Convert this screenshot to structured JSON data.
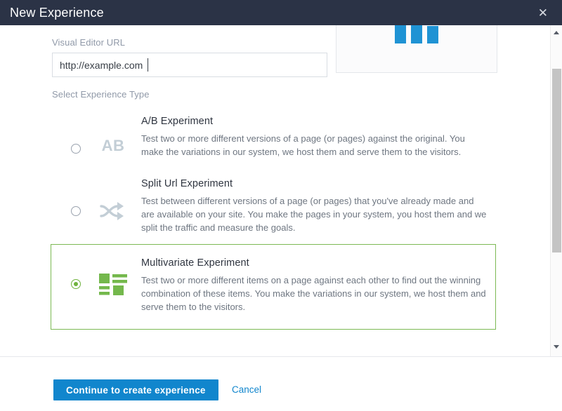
{
  "window": {
    "title": "New Experience",
    "close_icon": "close-icon",
    "close_label": "✕"
  },
  "form": {
    "url_field": {
      "label": "Visual Editor URL",
      "value": "http://example.com",
      "placeholder": "http://example.com"
    },
    "section_label": "Select Experience Type"
  },
  "preview": {
    "icon_name": "bar-chart-icon",
    "bars": [
      27,
      33,
      25
    ],
    "bar_color": "#1f93d4"
  },
  "options": [
    {
      "id": "ab-experiment",
      "icon_name": "ab-icon",
      "icon_text": "AB",
      "title": "A/B Experiment",
      "description": "Test two or more different versions of a page (or pages) against the original. You make the variations in our system, we host them and serve them to the visitors.",
      "selected": false
    },
    {
      "id": "split-url-experiment",
      "icon_name": "split-arrows-icon",
      "icon_text": "",
      "title": "Split Url Experiment",
      "description": "Test between different versions of a page (or pages) that you've already made and are available on your site. You make the pages in your system, you host them and we split the traffic and measure the goals.",
      "selected": false
    },
    {
      "id": "multivariate-experiment",
      "icon_name": "multivariate-grid-icon",
      "icon_text": "",
      "title": "Multivariate Experiment",
      "description": "Test two or more different items on a page against each other to find out the winning combination of these items. You make the variations in our system, we host them and serve them to the visitors.",
      "selected": true
    }
  ],
  "footer": {
    "primary_label": "Continue to create experience",
    "cancel_label": "Cancel"
  },
  "colors": {
    "titlebar": "#2b3346",
    "primary": "#1186cd",
    "selected_border": "#7cb954",
    "selected_accent": "#6fb23e",
    "muted_text": "#9099a8"
  },
  "scrollbar": {
    "up_icon": "chevron-up-icon",
    "down_icon": "chevron-down-icon"
  }
}
